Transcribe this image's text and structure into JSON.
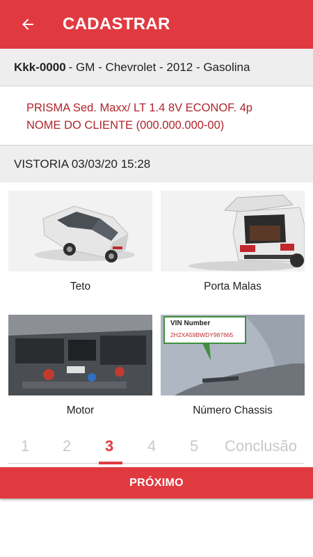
{
  "appbar": {
    "title": "CADASTRAR",
    "back_icon": "arrow-left-icon"
  },
  "vehicle": {
    "plate": "Kkk-0000",
    "details": "- GM - Chevrolet - 2012 - Gasolina",
    "model": "PRISMA Sed. Maxx/ LT 1.4 8V ECONOF. 4p",
    "client": "NOME DO CLIENTE (000.000.000-00)"
  },
  "inspection": {
    "label": "VISTORIA 03/03/20 15:28"
  },
  "photos": [
    {
      "caption": "Teto"
    },
    {
      "caption": "Porta Malas"
    },
    {
      "caption": "Motor"
    },
    {
      "caption": "Número Chassis"
    }
  ],
  "vin_tag": {
    "title": "VIN Number",
    "code": "2H2XA59BWDY987665"
  },
  "steps": [
    "1",
    "2",
    "3",
    "4",
    "5",
    "Conclusão"
  ],
  "current_step": 3,
  "next_button": "PRÓXIMO",
  "colors": {
    "primary": "#e03a40",
    "accent_text": "#b0242a"
  }
}
